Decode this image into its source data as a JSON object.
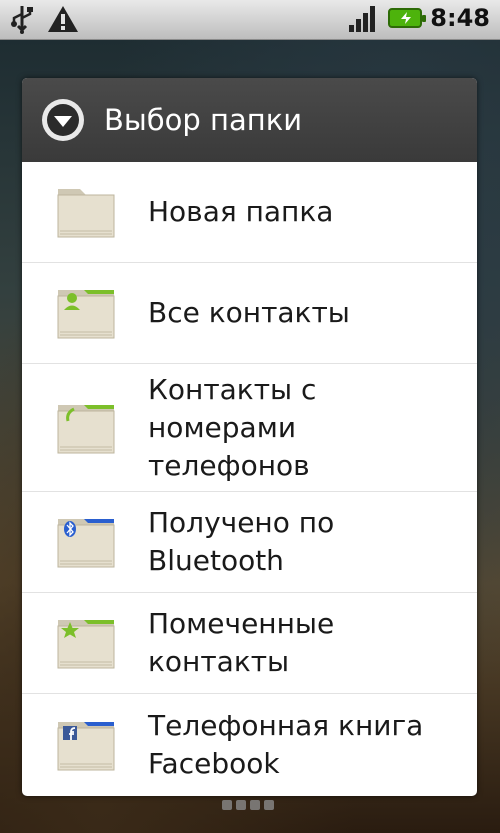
{
  "status_bar": {
    "time": "8:48",
    "icons": [
      "usb-icon",
      "warning-icon",
      "signal-icon",
      "battery-charging-icon"
    ]
  },
  "dialog": {
    "title": "Выбор папки",
    "title_icon": "dropdown-circle-icon",
    "items": [
      {
        "label": "Новая папка",
        "icon": "folder-icon",
        "accent": ""
      },
      {
        "label": "Все контакты",
        "icon": "contacts-folder-icon",
        "accent": "#7cbf2a"
      },
      {
        "label": "Контакты с номерами телефонов",
        "icon": "phone-folder-icon",
        "accent": "#7cbf2a"
      },
      {
        "label": "Получено по Bluetooth",
        "icon": "bluetooth-folder-icon",
        "accent": "#2a5fcf"
      },
      {
        "label": "Помеченные контакты",
        "icon": "star-folder-icon",
        "accent": "#7cbf2a"
      },
      {
        "label": "Телефонная книга Facebook",
        "icon": "facebook-folder-icon",
        "accent": "#2a5fcf"
      }
    ]
  }
}
